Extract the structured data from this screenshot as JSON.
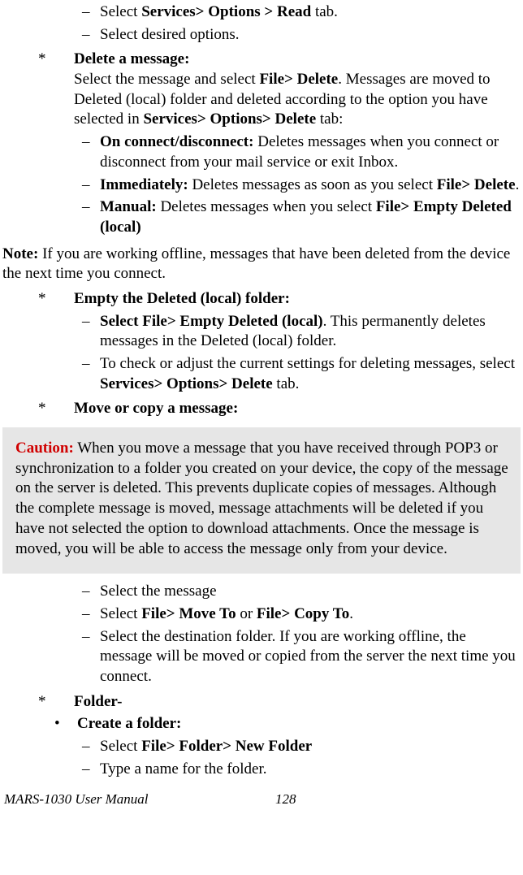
{
  "items": {
    "i1": {
      "text": "Select ",
      "bold1": "Services> Options > Read",
      "tail": " tab."
    },
    "i2": {
      "text": "Select desired options."
    },
    "delete_title": "Delete a message:",
    "delete_body_pre": "Select the message and select ",
    "delete_body_b1": "File> Delete",
    "delete_body_mid": ". Messages are moved to Deleted (local) folder and deleted according to the option you have selected in ",
    "delete_body_b2": "Services> Options> Delete",
    "delete_body_tail": " tab:",
    "d1": {
      "b": "On connect/disconnect:",
      "t": " Deletes messages when you connect or disconnect from your mail service or exit Inbox."
    },
    "d2": {
      "b": "Immediately:",
      "t": " Deletes messages as soon as you select ",
      "b2": "File> Delete",
      "t2": "."
    },
    "d3": {
      "b": "Manual:",
      "t": " Deletes messages when you select ",
      "b2": "File> Empty Deleted (local)"
    },
    "note_b": "Note:",
    "note_t": " If you are working offline, messages that have been deleted from the device the next time you connect.",
    "empty_title": "Empty the Deleted (local) folder:",
    "e1": {
      "b": "Select File> Empty Deleted (local)",
      "t": ". This permanently deletes messages in the Deleted (local) folder."
    },
    "e2": {
      "t": "To check or adjust the current settings for deleting messages, select ",
      "b": "Services> Options> Delete",
      "t2": " tab."
    },
    "move_title": "Move or copy a message:",
    "caution_label": "Caution:",
    "caution_text": " When you move a message that you have received through POP3 or synchronization to a folder you created on your device, the copy of the message on the server is deleted. This prevents duplicate copies of messages. Although the complete message is moved, message attachments will be deleted if you have not selected the option to download attachments. Once the message is moved, you will be able to access the message only from your device.",
    "m1": "Select the message",
    "m2": {
      "t": "Select ",
      "b": "File> Move To",
      "t2": " or ",
      "b2": "File> Copy To",
      "t3": "."
    },
    "m3": "Select the destination folder. If you are working offline, the message will be moved or copied from the server the next time you connect.",
    "folder_title": "Folder-",
    "create_folder": "Create a folder:",
    "f1": {
      "t": "Select ",
      "b": "File> Folder> New Folder"
    },
    "f2": "Type a name for the folder."
  },
  "footer": {
    "manual": "MARS-1030 User Manual",
    "page": "128"
  },
  "marks": {
    "dash": "–",
    "star": "*",
    "bullet": "•"
  }
}
